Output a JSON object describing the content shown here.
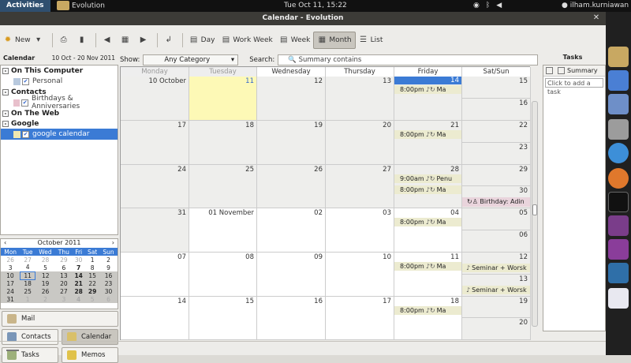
{
  "topbar": {
    "activities": "Activities",
    "app_name": "Evolution",
    "clock": "Tue Oct 11, 15:22",
    "user": "ilham.kurniawan"
  },
  "window": {
    "title": "Calendar - Evolution"
  },
  "toolbar": {
    "new": "New",
    "day": "Day",
    "work_week": "Work Week",
    "week": "Week",
    "month": "Month",
    "list": "List"
  },
  "sidebar": {
    "title": "Calendar",
    "range": "10 Oct - 20 Nov 2011",
    "groups": [
      {
        "label": "On This Computer",
        "sources": [
          {
            "label": "Personal",
            "color": "#b8c9de"
          }
        ]
      },
      {
        "label": "Contacts",
        "sources": [
          {
            "label": "Birthdays & Anniversaries",
            "color": "#e8c0cc"
          }
        ]
      },
      {
        "label": "On The Web",
        "sources": []
      },
      {
        "label": "Google",
        "sources": [
          {
            "label": "google calendar",
            "color": "#f0e8b0"
          }
        ]
      }
    ]
  },
  "minical": {
    "month": "October 2011",
    "days": [
      "Mon",
      "Tue",
      "Wed",
      "Thu",
      "Fri",
      "Sat",
      "Sun"
    ],
    "weeks": [
      [
        "26",
        "27",
        "28",
        "29",
        "30",
        "1",
        "2"
      ],
      [
        "3",
        "4",
        "5",
        "6",
        "7",
        "8",
        "9"
      ],
      [
        "10",
        "11",
        "12",
        "13",
        "14",
        "15",
        "16"
      ],
      [
        "17",
        "18",
        "19",
        "20",
        "21",
        "22",
        "23"
      ],
      [
        "24",
        "25",
        "26",
        "27",
        "28",
        "29",
        "30"
      ],
      [
        "31",
        "1",
        "2",
        "3",
        "4",
        "5",
        "6"
      ]
    ]
  },
  "switcher": {
    "mail": "Mail",
    "contacts": "Contacts",
    "calendar": "Calendar",
    "tasks": "Tasks",
    "memos": "Memos"
  },
  "search": {
    "show_label": "Show:",
    "category": "Any Category",
    "search_label": "Search:",
    "placeholder": "Summary contains"
  },
  "calendar": {
    "headers": [
      "Monday",
      "Tuesday",
      "Wednesday",
      "Thursday",
      "Friday",
      "Sat/Sun"
    ],
    "rows": [
      {
        "days": [
          "10 October",
          "11",
          "12",
          "13",
          "14"
        ],
        "sat": "15",
        "sun": "16"
      },
      {
        "days": [
          "17",
          "18",
          "19",
          "20",
          "21"
        ],
        "sat": "22",
        "sun": "23"
      },
      {
        "days": [
          "24",
          "25",
          "26",
          "27",
          "28"
        ],
        "sat": "29",
        "sun": "30"
      },
      {
        "days": [
          "31",
          "01 November",
          "02",
          "03",
          "04"
        ],
        "sat": "05",
        "sun": "06"
      },
      {
        "days": [
          "07",
          "08",
          "09",
          "10",
          "11"
        ],
        "sat": "12",
        "sun": "13"
      },
      {
        "days": [
          "14",
          "15",
          "16",
          "17",
          "18"
        ],
        "sat": "19",
        "sun": "20"
      }
    ],
    "events": {
      "fri_1_time": "8:00pm",
      "fri_1_title": "Ma",
      "fri_2_time": "8:00pm",
      "fri_2_title": "Ma",
      "fri_3a_time": "9:00am",
      "fri_3a_title": "Penu",
      "fri_3b_time": "8:00pm",
      "fri_3b_title": "Ma",
      "birthday": "Birthday: Adin",
      "fri_4_time": "8:00pm",
      "fri_4_title": "Ma",
      "fri_5_time": "8:00pm",
      "fri_5_title": "Ma",
      "sat_5": "Seminar + Worsk",
      "sun_5": "Seminar + Worsk",
      "fri_6_time": "8:00pm",
      "fri_6_title": "Ma"
    }
  },
  "tasks": {
    "title": "Tasks",
    "summary_col": "Summary",
    "add_placeholder": "Click to add a task"
  }
}
